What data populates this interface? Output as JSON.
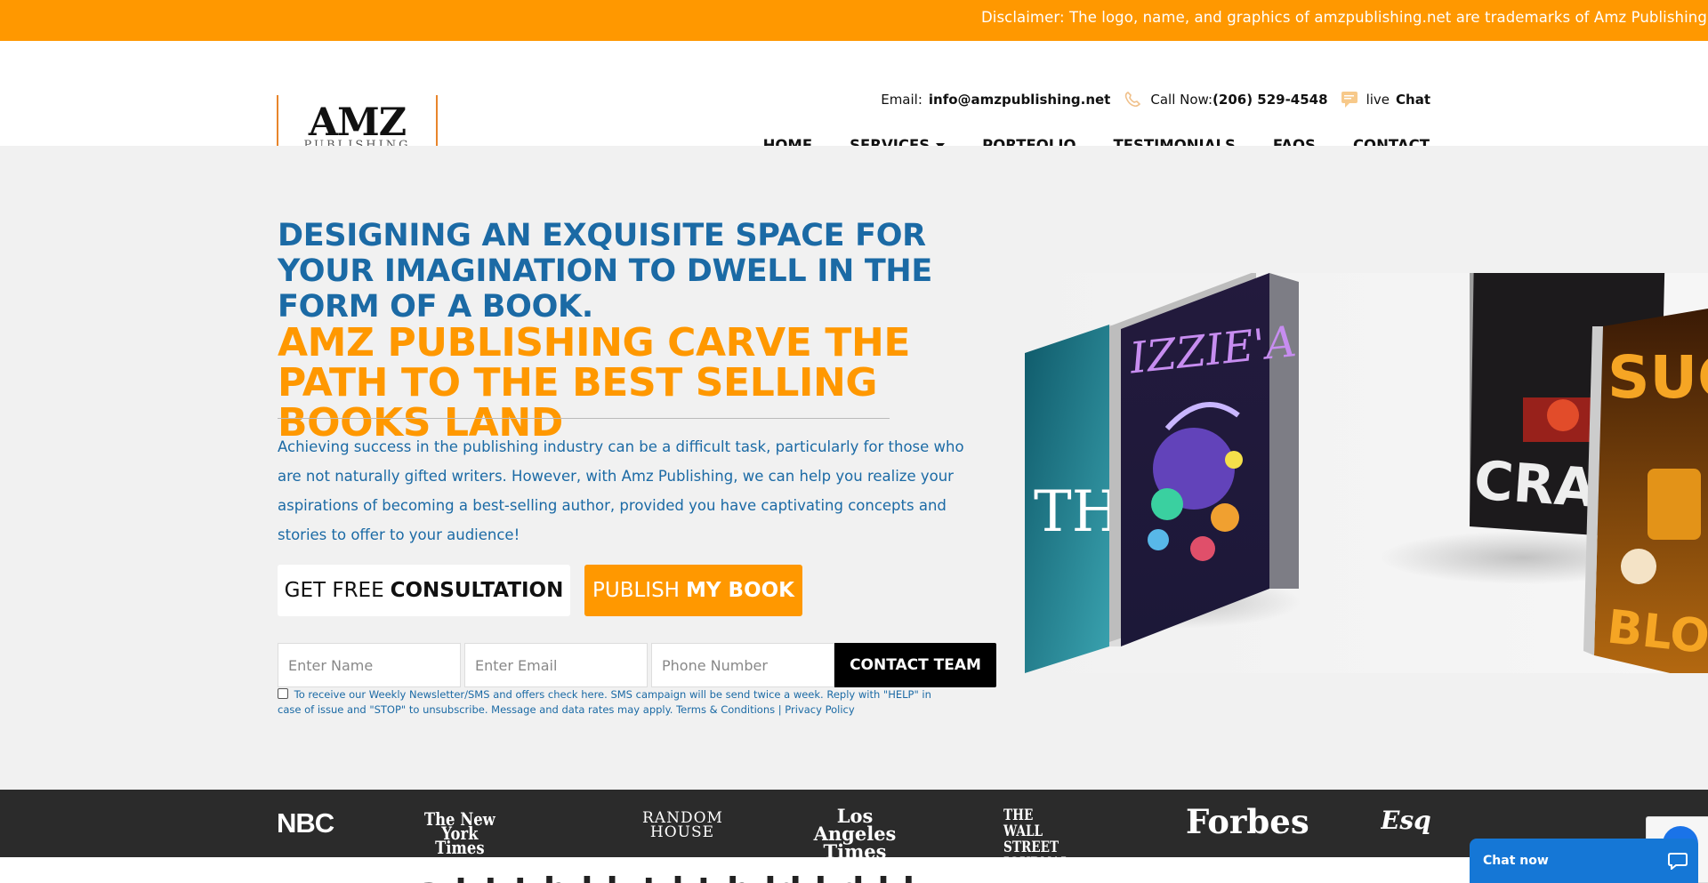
{
  "topbar": {
    "disclaimer": "Disclaimer: The logo, name, and graphics of amzpublishing.net are trademarks of Amz Publishing.com"
  },
  "logo": {
    "big": "AMZ",
    "small": "PUBLISHING"
  },
  "contact": {
    "email_label": "Email:",
    "email": "info@amzpublishing.net",
    "call_label": "Call Now:",
    "phone": "(206) 529-4548",
    "live_label": "live",
    "chat_label": "Chat"
  },
  "nav": {
    "home": "HOME",
    "services": "SERVICES",
    "portfolio": "PORTFOLIO",
    "testimonials": "TESTIMONIALS",
    "faqs": "FAQS",
    "contact": "CONTACT"
  },
  "hero": {
    "headline_1": "DESIGNING AN EXQUISITE SPACE FOR YOUR IMAGINATION TO DWELL IN THE FORM OF A BOOK.",
    "headline_2": "AMZ PUBLISHING CARVE THE PATH TO THE BEST SELLING BOOKS LAND",
    "paragraph": "Achieving success in the publishing industry can be a difficult task, particularly for those who are not naturally gifted writers. However, with Amz Publishing, we can help you realize your aspirations of becoming a best-selling author, provided you have captivating concepts and stories to offer to your audience!",
    "btn_consult_light": "GET FREE",
    "btn_consult_bold": "CONSULTATION",
    "btn_publish_light": "PUBLISH",
    "btn_publish_bold": "MY BOOK"
  },
  "form": {
    "name_placeholder": "Enter Name",
    "email_placeholder": "Enter Email",
    "phone_placeholder": "Phone Number",
    "submit_label": "CONTACT TEAM",
    "consent_text": "To receive our Weekly Newsletter/SMS and offers check here. SMS campaign will be send twice a week. Reply with \"HELP\" in case of issue and \"STOP\" to unsubscribe. Message and data rates may apply.",
    "terms_link": "Terms & Conditions",
    "separator": "|",
    "privacy_link": "Privacy Policy"
  },
  "books": {
    "book1_title": "IZZIE'A",
    "book2_title": "CRASH",
    "book3_title": "SUG",
    "book3_sub": "BLOSSO",
    "book0_letters": "TH"
  },
  "press_logos": [
    "NBC",
    "The New York Times",
    "RANDOM HOUSE",
    "Los Angeles Times",
    "THE WALL STREET JOURNAL.",
    "Forbes",
    "Esqu"
  ],
  "below_cut": "a   t  t    t  h  l   k  t  l  t  h  ld   l  d  l   l",
  "chat_widget": {
    "label": "Chat now"
  },
  "colors": {
    "orange": "#ff9800",
    "blue": "#1b6aa5",
    "dark": "#2b2b2b"
  }
}
